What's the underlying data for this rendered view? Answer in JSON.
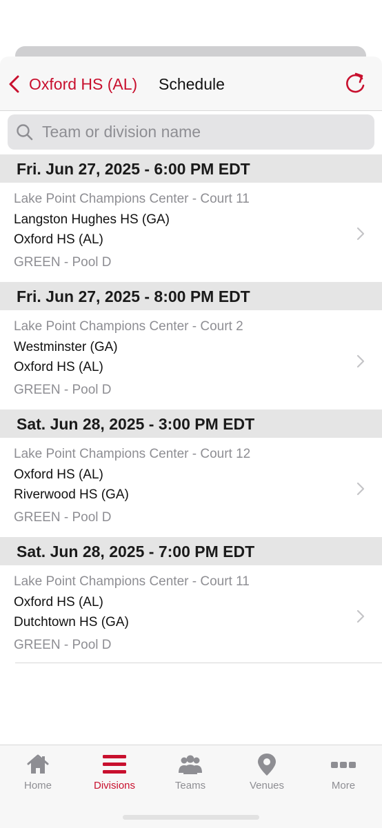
{
  "header": {
    "back_label": "Oxford HS (AL)",
    "title": "Schedule"
  },
  "search": {
    "placeholder": "Team or division name",
    "value": ""
  },
  "games": [
    {
      "date_header": "Fri. Jun 27, 2025 - 6:00 PM EDT",
      "venue": "Lake Point Champions Center - Court 11",
      "team1": "Langston Hughes HS (GA)",
      "team2": "Oxford HS (AL)",
      "pool": "GREEN - Pool D"
    },
    {
      "date_header": "Fri. Jun 27, 2025 - 8:00 PM EDT",
      "venue": "Lake Point Champions Center - Court 2",
      "team1": "Westminster (GA)",
      "team2": "Oxford HS (AL)",
      "pool": "GREEN - Pool D"
    },
    {
      "date_header": "Sat. Jun 28, 2025 - 3:00 PM EDT",
      "venue": "Lake Point Champions Center - Court 12",
      "team1": "Oxford HS (AL)",
      "team2": "Riverwood HS (GA)",
      "pool": "GREEN - Pool D"
    },
    {
      "date_header": "Sat. Jun 28, 2025 - 7:00 PM EDT",
      "venue": "Lake Point Champions Center - Court 11",
      "team1": "Oxford HS (AL)",
      "team2": "Dutchtown HS (GA)",
      "pool": "GREEN - Pool D"
    }
  ],
  "tabs": [
    {
      "label": "Home",
      "icon": "home-icon",
      "active": false
    },
    {
      "label": "Divisions",
      "icon": "divisions-icon",
      "active": true
    },
    {
      "label": "Teams",
      "icon": "teams-icon",
      "active": false
    },
    {
      "label": "Venues",
      "icon": "location-pin-icon",
      "active": false
    },
    {
      "label": "More",
      "icon": "more-icon",
      "active": false
    }
  ],
  "colors": {
    "accent": "#c8102e",
    "inactive": "#8e8e93",
    "date_header_bg": "#e5e5e5"
  }
}
